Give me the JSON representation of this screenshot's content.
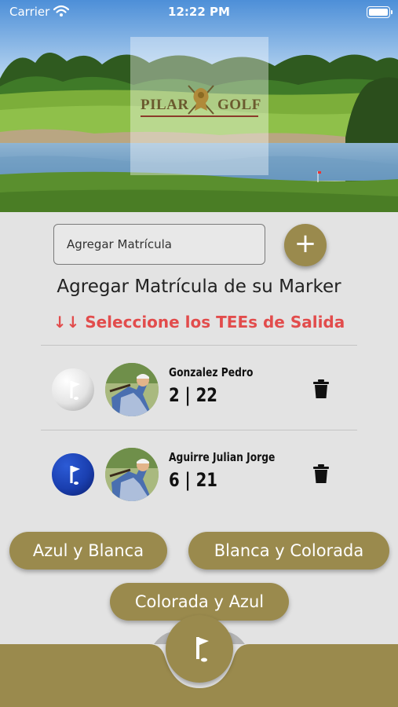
{
  "status_bar": {
    "carrier": "Carrier",
    "time": "12:22 PM",
    "wifi_icon": "wifi-icon",
    "battery_icon": "battery-icon"
  },
  "header": {
    "logo_left": "PILAR",
    "logo_right": "GOLF",
    "logo_icon": "lion-crest-icon"
  },
  "matricula": {
    "placeholder": "Agregar Matrícula",
    "add_icon": "plus-icon"
  },
  "heading": "Agregar Matrícula de su Marker",
  "tee_warning": "↓↓ Seleccione los TEEs de Salida",
  "players": [
    {
      "name": "Gonzalez Pedro",
      "score": "2 | 22",
      "tee_color": "white",
      "tee_icon": "golf-flag-icon",
      "delete_icon": "trash-icon"
    },
    {
      "name": "Aguirre Julian Jorge",
      "score": "6 | 21",
      "tee_color": "blue",
      "tee_icon": "golf-flag-icon",
      "delete_icon": "trash-icon"
    }
  ],
  "tee_options": [
    {
      "label": "Azul y Blanca"
    },
    {
      "label": "Blanca y Colorada"
    },
    {
      "label": "Colorada y Azul"
    }
  ],
  "bottom_bar": {
    "fab_icon": "golf-flag-icon"
  },
  "colors": {
    "accent": "#9a8a4d",
    "warning": "#e24c4c",
    "background": "#e3e3e3",
    "tee_white": "#e4e4e4",
    "tee_blue": "#1a3fb0"
  }
}
